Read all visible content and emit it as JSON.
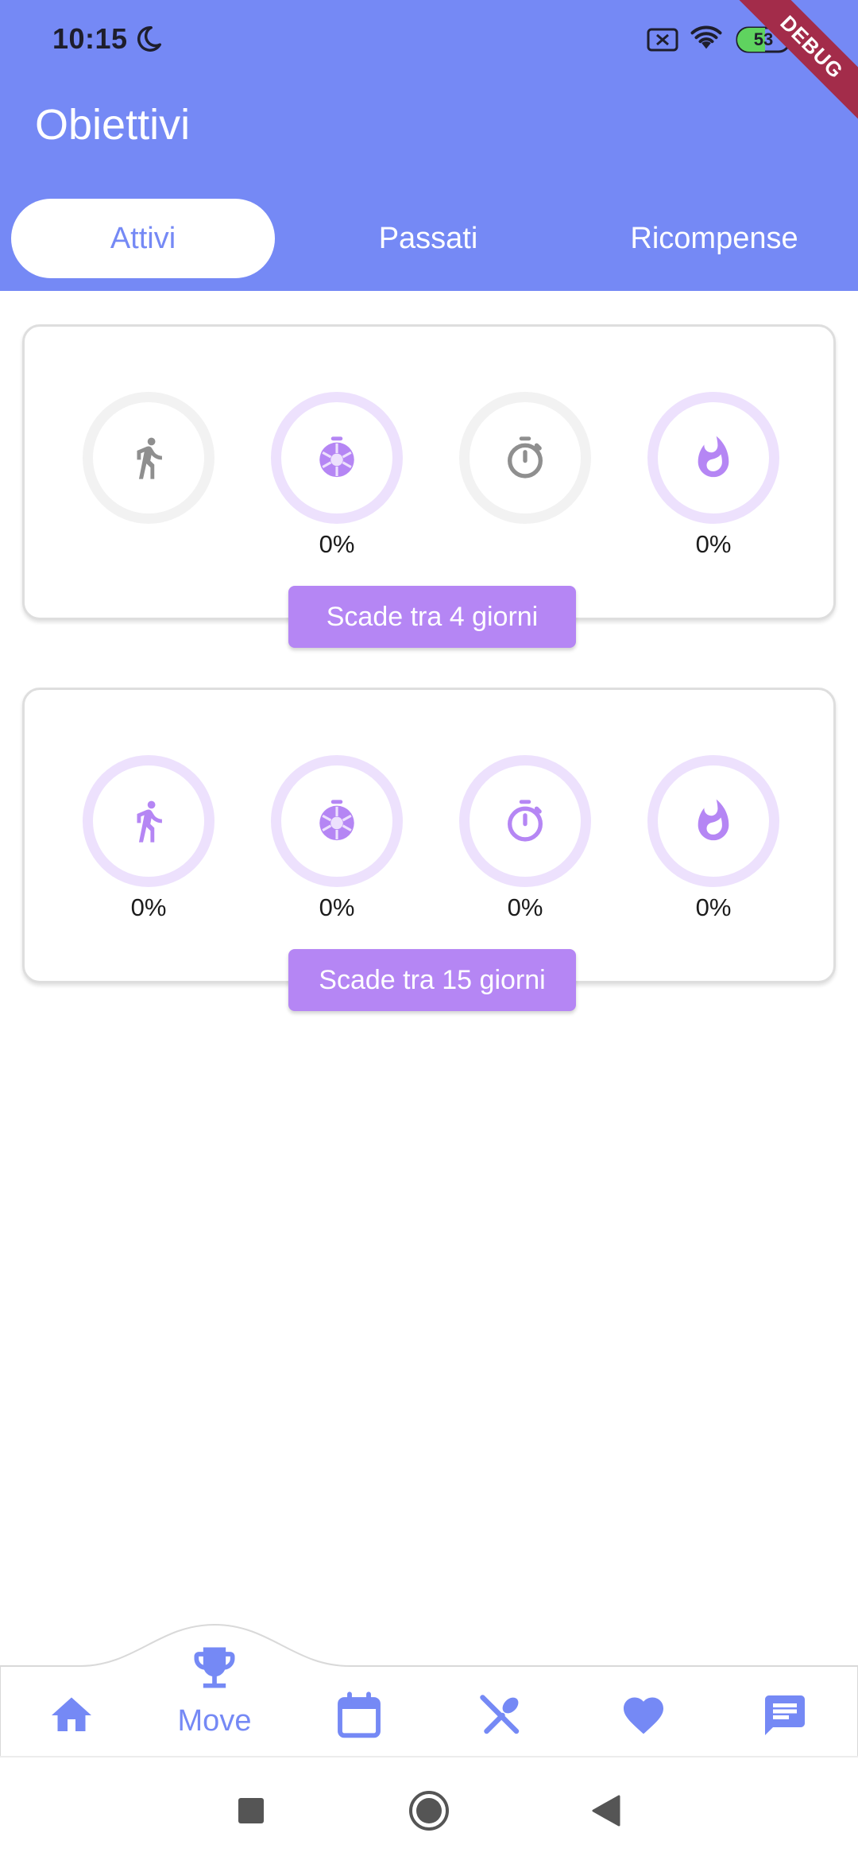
{
  "status_bar": {
    "time": "10:15",
    "battery": "53"
  },
  "debug_banner": "DEBUG",
  "app_bar": {
    "title": "Obiettivi"
  },
  "tabs": [
    {
      "label": "Attivi",
      "active": true
    },
    {
      "label": "Passati",
      "active": false
    },
    {
      "label": "Ricompense",
      "active": false
    }
  ],
  "goals": [
    {
      "metrics": [
        {
          "icon": "walk-icon",
          "percent": "",
          "color": "gray"
        },
        {
          "icon": "shutter-icon",
          "percent": "0%",
          "color": "purple"
        },
        {
          "icon": "timer-icon",
          "percent": "",
          "color": "gray"
        },
        {
          "icon": "flame-icon",
          "percent": "0%",
          "color": "purple"
        }
      ],
      "due": "Scade tra 4 giorni"
    },
    {
      "metrics": [
        {
          "icon": "walk-icon",
          "percent": "0%",
          "color": "purple"
        },
        {
          "icon": "shutter-icon",
          "percent": "0%",
          "color": "purple"
        },
        {
          "icon": "timer-icon",
          "percent": "0%",
          "color": "purple"
        },
        {
          "icon": "flame-icon",
          "percent": "0%",
          "color": "purple"
        }
      ],
      "due": "Scade tra 15 giorni"
    }
  ],
  "bottom_nav": {
    "active_label": "Move",
    "items": [
      "home-icon",
      "trophy-icon",
      "calendar-icon",
      "utensils-icon",
      "heart-icon",
      "chat-icon"
    ]
  },
  "colors": {
    "primary": "#7589f5",
    "accent_purple": "#b586f4",
    "ring_purple": "#ede1fd",
    "ring_gray": "#f2f2f2",
    "debug": "#a32c4a"
  }
}
